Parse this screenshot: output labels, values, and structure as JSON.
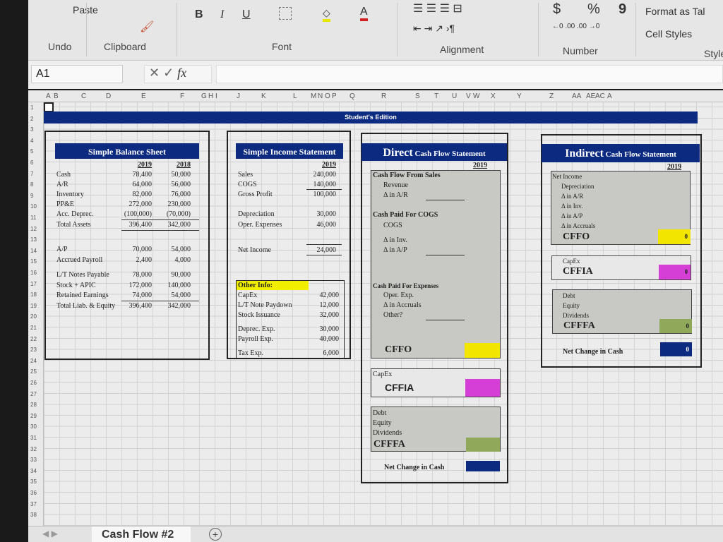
{
  "ribbon": {
    "paste": "Paste",
    "undo": "Undo",
    "groups": {
      "clipboard": "Clipboard",
      "font": "Font",
      "alignment": "Alignment",
      "number": "Number",
      "styles": "Style"
    },
    "font_buttons": {
      "bold": "B",
      "italic": "I",
      "underline": "U",
      "color": "A"
    },
    "number": {
      "currency": "$",
      "percent": "%",
      "comma": "9"
    },
    "styles": {
      "format_table": "Format as Tal",
      "cell_styles": "Cell Styles"
    }
  },
  "formula_bar": {
    "name_box": "A1",
    "fx": "fx",
    "value": ""
  },
  "columns": [
    "A",
    "B",
    "C",
    "D",
    "E",
    "F",
    "G",
    "H",
    "I",
    "J",
    "K",
    "L",
    "M",
    "N",
    "O",
    "P",
    "Q",
    "R",
    "S",
    "T",
    "U",
    "V",
    "W",
    "X",
    "Y",
    "Z",
    "AA",
    "AE",
    "AC",
    "A"
  ],
  "banner": "Student's Edition",
  "balance_sheet": {
    "title": "Simple Balance Sheet",
    "years": [
      "2019",
      "2018"
    ],
    "assets": [
      [
        "Cash",
        "78,400",
        "50,000"
      ],
      [
        "A/R",
        "64,000",
        "56,000"
      ],
      [
        "Inventory",
        "82,000",
        "76,000"
      ],
      [
        "PP&E",
        "272,000",
        "230,000"
      ],
      [
        "Acc. Deprec.",
        "(100,000)",
        "(70,000)"
      ],
      [
        "Total Assets",
        "396,400",
        "342,000"
      ]
    ],
    "liabilities": [
      [
        "A/P",
        "70,000",
        "54,000"
      ],
      [
        "Accrued Payroll",
        "2,400",
        "4,000"
      ],
      [
        "L/T Notes Payable",
        "78,000",
        "90,000"
      ],
      [
        "Stock + APIC",
        "172,000",
        "140,000"
      ],
      [
        "Retained Earnings",
        "74,000",
        "54,000"
      ],
      [
        "Total Liab. & Equity",
        "396,400",
        "342,000"
      ]
    ]
  },
  "income_statement": {
    "title": "Simple Income Statement",
    "year": "2019",
    "rows": [
      [
        "Sales",
        "240,000"
      ],
      [
        "COGS",
        "140,000"
      ],
      [
        "Gross Profit",
        "100,000"
      ],
      [
        "Depreciation",
        "30,000"
      ],
      [
        "Oper. Expenses",
        "46,000"
      ],
      [
        "Net Income",
        "24,000"
      ]
    ],
    "other_info": {
      "title": "Other Info:",
      "rows": [
        [
          "CapEx",
          "42,000"
        ],
        [
          "L/T Note Paydown",
          "12,000"
        ],
        [
          "Stock Issuance",
          "32,000"
        ],
        [
          "Deprec. Exp.",
          "30,000"
        ],
        [
          "Payroll Exp.",
          "40,000"
        ],
        [
          "Tax Exp.",
          "6,000"
        ]
      ]
    }
  },
  "direct": {
    "title_big": "Direct",
    "title_rest": " Cash Flow Statement",
    "year": "2019",
    "sales": {
      "title": "Cash Flow From Sales",
      "items": [
        "Revenue",
        "Δ in A/R"
      ]
    },
    "cogs": {
      "title": "Cash Paid For COGS",
      "items": [
        "COGS",
        "Δ in Inv.",
        "Δ in A/P"
      ]
    },
    "expenses": {
      "title": "Cash Paid For Expenses",
      "items": [
        "Oper. Exp.",
        "Δ in Accruals",
        "Other?"
      ]
    },
    "cffo": "CFFO",
    "capex": "CapEx",
    "cffia": "CFFIA",
    "financing": [
      "Debt",
      "Equity",
      "Dividends"
    ],
    "cfffa": "CFFFA",
    "net_change": "Net Change in Cash"
  },
  "indirect": {
    "title_big": "Indirect",
    "title_rest": " Cash Flow Statement",
    "year": "2019",
    "operating": [
      "Net Income",
      "Depreciation",
      "Δ in A/R",
      "Δ in Inv.",
      "Δ in A/P",
      "Δ in Accruals"
    ],
    "cffo": "CFFO",
    "cffo_value": "0",
    "capex": "CapEx",
    "cffia": "CFFIA",
    "cffia_value": "0",
    "financing": [
      "Debt",
      "Equity",
      "Dividends"
    ],
    "cfffa": "CFFFA",
    "cfffa_value": "0",
    "net_change": "Net Change in Cash",
    "net_change_value": "0"
  },
  "colors": {
    "header": "#0b2a80",
    "cffo": "#f2e600",
    "cffia": "#d63fd6",
    "cfffa": "#8fa85a",
    "net": "#0b2a80"
  },
  "sheet_tab": "Cash Flow #2",
  "add_sheet": "+"
}
